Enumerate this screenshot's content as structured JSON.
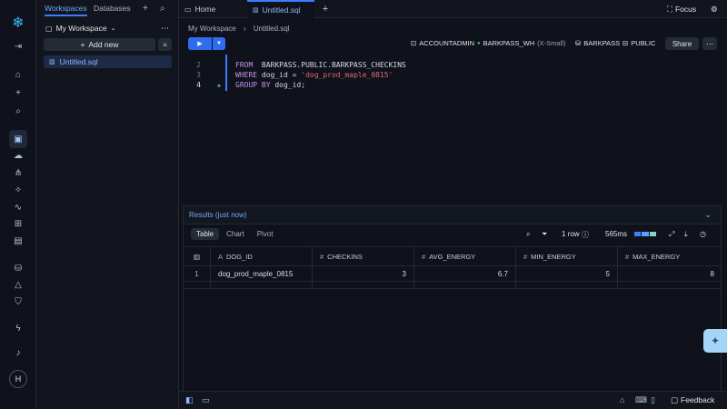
{
  "colors": {
    "accent": "#3d7dff",
    "warehouse_dot": "#3fc37a"
  },
  "sidebar": {
    "tabs": [
      "Workspaces",
      "Databases"
    ],
    "workspace": "My Workspace",
    "add_new": "Add new",
    "files": [
      "Untitled.sql"
    ]
  },
  "tabs": [
    {
      "label": "Home"
    },
    {
      "label": "Untitled.sql"
    }
  ],
  "top_right": {
    "focus": "Focus"
  },
  "breadcrumb": [
    "My Workspace",
    "Untitled.sql"
  ],
  "context": {
    "role": "ACCOUNTADMIN",
    "warehouse": "BARKPASS_WH",
    "warehouse_size": "(X-Small)",
    "database": "BARKPASS",
    "schema": "PUBLIC",
    "share": "Share"
  },
  "editor": {
    "lines": [
      {
        "n": "2",
        "parts": [
          [
            "kw",
            "FROM"
          ],
          [
            "",
            "  BARKPASS.PUBLIC.BARKPASS_CHECKINS"
          ]
        ]
      },
      {
        "n": "3",
        "parts": [
          [
            "kw",
            "WHERE"
          ],
          [
            "",
            " dog_id = "
          ],
          [
            "str",
            "'dog_prod_maple_0815'"
          ]
        ]
      },
      {
        "n": "4",
        "parts": [
          [
            "kw",
            "GROUP BY"
          ],
          [
            "",
            " dog_id;"
          ]
        ]
      }
    ]
  },
  "results": {
    "title": "Results (just now)",
    "view_tabs": [
      "Table",
      "Chart",
      "Pivot"
    ],
    "row_count": "1 row",
    "duration": "565ms",
    "columns": [
      "DOG_ID",
      "CHECKINS",
      "AVG_ENERGY",
      "MIN_ENERGY",
      "MAX_ENERGY"
    ],
    "rows": [
      {
        "index": "1",
        "cells": [
          "dog_prod_maple_0815",
          "3",
          "6.7",
          "5",
          "8"
        ]
      }
    ]
  },
  "bottom": {
    "feedback": "Feedback"
  },
  "rail": {
    "avatar": "H"
  }
}
